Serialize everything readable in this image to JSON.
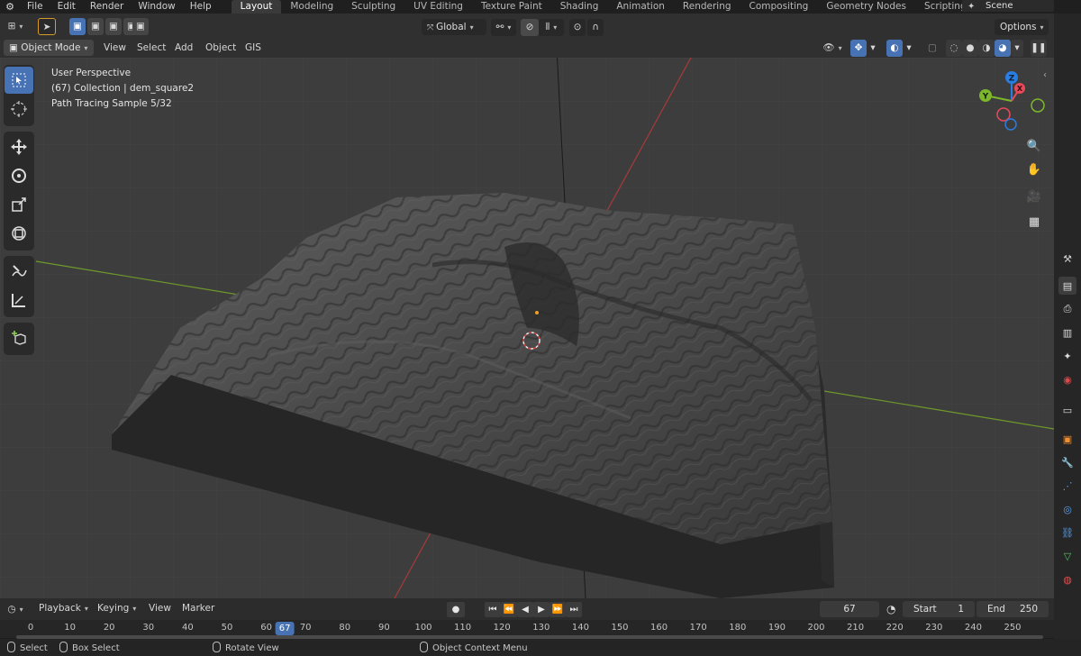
{
  "menu": {
    "items": [
      "File",
      "Edit",
      "Render",
      "Window",
      "Help"
    ]
  },
  "workspaces": {
    "active": "Layout",
    "tabs": [
      "Layout",
      "Modeling",
      "Sculpting",
      "UV Editing",
      "Texture Paint",
      "Shading",
      "Animation",
      "Rendering",
      "Compositing",
      "Geometry Nodes",
      "Scripting"
    ],
    "add_label": "+"
  },
  "scene": {
    "name": "Scene"
  },
  "header": {
    "transform_orientation": "Global",
    "options_label": "Options"
  },
  "mode_bar": {
    "mode": "Object Mode",
    "menus": [
      "View",
      "Select",
      "Add",
      "Object",
      "GIS"
    ]
  },
  "viewport": {
    "info_lines": [
      "User Perspective",
      "(67) Collection | dem_square2",
      "Path Tracing Sample 5/32"
    ]
  },
  "gizmo": {
    "x": "X",
    "y": "Y",
    "z": "Z"
  },
  "timeline": {
    "menus": [
      "Playback",
      "Keying",
      "View",
      "Marker"
    ],
    "current_frame": "67",
    "start_label": "Start",
    "start_value": "1",
    "end_label": "End",
    "end_value": "250",
    "ticks": [
      "0",
      "10",
      "20",
      "30",
      "40",
      "50",
      "60",
      "70",
      "80",
      "90",
      "100",
      "110",
      "120",
      "130",
      "140",
      "150",
      "160",
      "170",
      "180",
      "190",
      "200",
      "210",
      "220",
      "230",
      "240",
      "250"
    ],
    "frame": 67
  },
  "statusbar": {
    "items": [
      "Select",
      "Box Select",
      "Rotate View",
      "Object Context Menu"
    ]
  },
  "colors": {
    "accent": "#4772b3",
    "axis_x": "#a83a3a",
    "axis_y": "#6e9a2a",
    "gizmo_x": "#e84a5a",
    "gizmo_y": "#7cb82a",
    "gizmo_z": "#2a7de1"
  }
}
